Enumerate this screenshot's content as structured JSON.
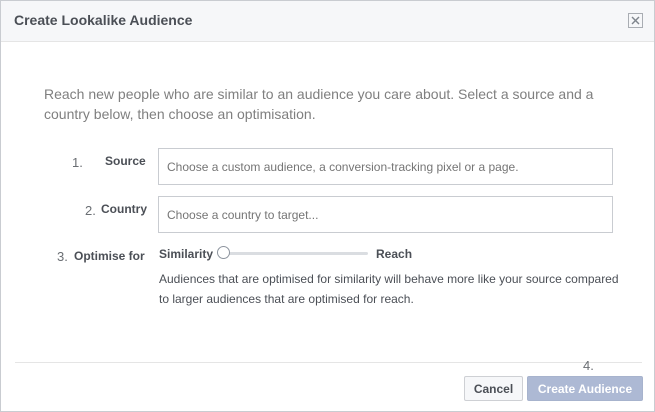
{
  "dialog": {
    "title": "Create Lookalike Audience",
    "close_icon": "close-icon",
    "intro": "Reach new people who are similar to an audience you care about. Select a source and a country below, then choose an optimisation."
  },
  "form": {
    "source": {
      "step": "1.",
      "label": "Source",
      "placeholder": "Choose a custom audience, a conversion-tracking pixel or a page."
    },
    "country": {
      "step": "2.",
      "label": "Country",
      "placeholder": "Choose a country to target..."
    },
    "optimise": {
      "step": "3.",
      "label": "Optimise for",
      "left_label": "Similarity",
      "right_label": "Reach",
      "value": 0,
      "description": "Audiences that are optimised for similarity will behave more like your source compared to larger audiences that are optimised for reach."
    }
  },
  "footer": {
    "step": "4.",
    "cancel_label": "Cancel",
    "create_label": "Create Audience"
  }
}
